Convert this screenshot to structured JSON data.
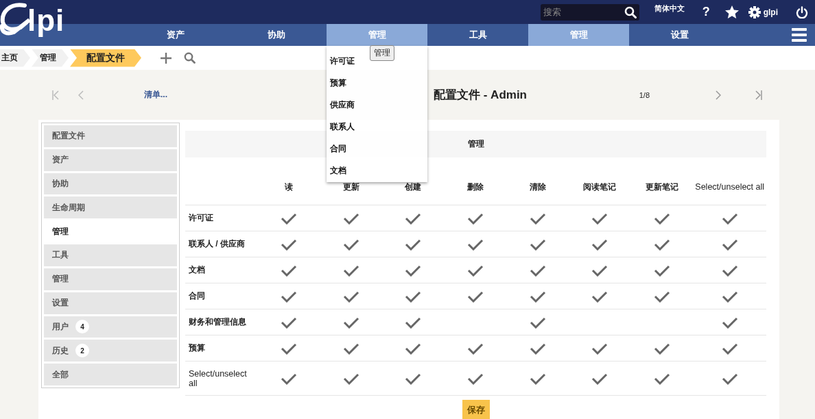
{
  "header": {
    "logo": "lpi",
    "search": {
      "placeholder": "搜索"
    },
    "language": "简体中文",
    "help": "?",
    "user": "glpi"
  },
  "menu": [
    {
      "label": "资产",
      "selected": false
    },
    {
      "label": "协助",
      "selected": false
    },
    {
      "label": "管理",
      "selected": true
    },
    {
      "label": "工具",
      "selected": false
    },
    {
      "label": "管理",
      "selected": true
    },
    {
      "label": "设置",
      "selected": false
    }
  ],
  "dropdown": {
    "tooltip": "管理",
    "items": [
      "许可证",
      "预算",
      "供应商",
      "联系人",
      "合同",
      "文档"
    ]
  },
  "breadcrumb": [
    "主页",
    "管理",
    "配置文件"
  ],
  "record_nav": {
    "list_link": "清单...",
    "title": "配置文件 - Admin",
    "position": "1/8"
  },
  "tabs": [
    {
      "label": "配置文件",
      "selected": false
    },
    {
      "label": "资产",
      "selected": false
    },
    {
      "label": "协助",
      "selected": false
    },
    {
      "label": "生命周期",
      "selected": false
    },
    {
      "label": "管理",
      "selected": true
    },
    {
      "label": "工具",
      "selected": false
    },
    {
      "label": "管理",
      "selected": false
    },
    {
      "label": "设置",
      "selected": false
    },
    {
      "label": "用户",
      "count": "4",
      "selected": false
    },
    {
      "label": "历史",
      "count": "2",
      "selected": false
    },
    {
      "label": "全部",
      "selected": false
    }
  ],
  "rights": {
    "group": "管理",
    "columns": [
      "读",
      "更新",
      "创建",
      "删除",
      "清除",
      "阅读笔记",
      "更新笔记",
      "Select/unselect all"
    ],
    "rows": [
      {
        "label": "许可证",
        "cells": [
          true,
          true,
          true,
          true,
          true,
          true,
          true,
          true
        ]
      },
      {
        "label": "联系人 / 供应商",
        "cells": [
          true,
          true,
          true,
          true,
          true,
          true,
          true,
          true
        ]
      },
      {
        "label": "文档",
        "cells": [
          true,
          true,
          true,
          true,
          true,
          true,
          true,
          true
        ]
      },
      {
        "label": "合同",
        "cells": [
          true,
          true,
          true,
          true,
          true,
          true,
          true,
          true
        ]
      },
      {
        "label": "财务和管理信息",
        "cells": [
          true,
          true,
          true,
          null,
          true,
          null,
          null,
          true
        ]
      },
      {
        "label": "预算",
        "cells": [
          true,
          true,
          true,
          true,
          true,
          true,
          true,
          true
        ]
      },
      {
        "label": "Select/unselect all",
        "cells": [
          true,
          true,
          true,
          true,
          true,
          true,
          true,
          true
        ]
      }
    ]
  },
  "save_button": "保存"
}
